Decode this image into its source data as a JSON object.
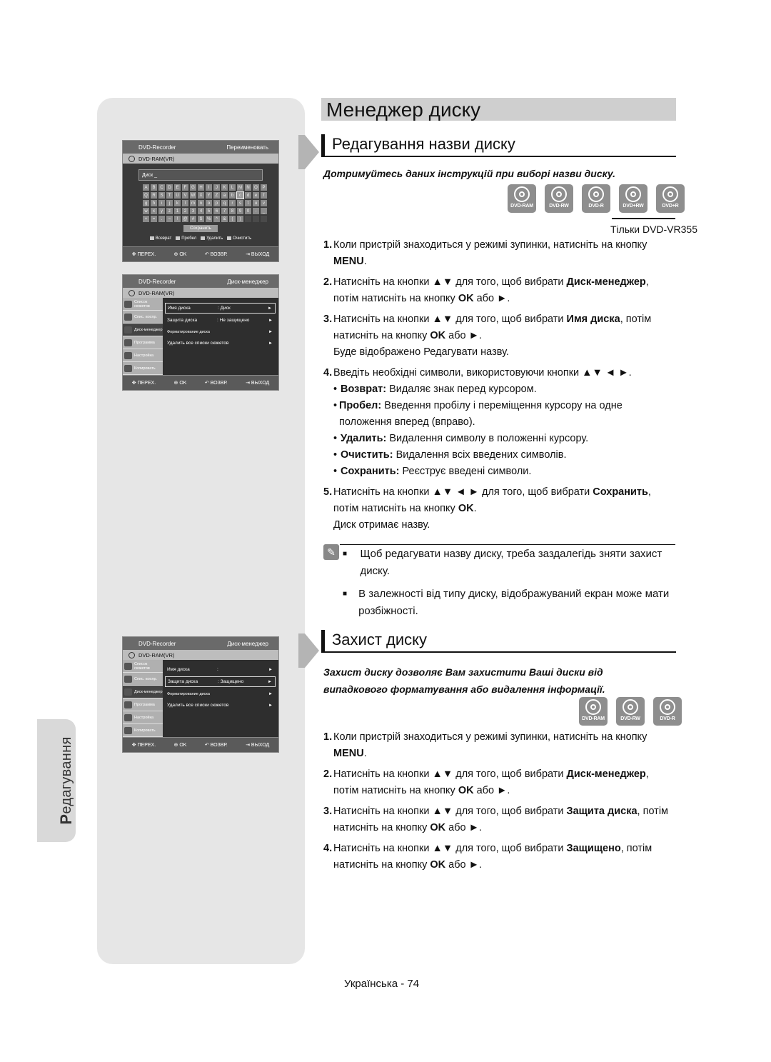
{
  "page": {
    "title": "Менеджер диску",
    "side_tab": {
      "cap": "Р",
      "rest": "едагування"
    },
    "footer": "Українська - 74"
  },
  "screen_rename": {
    "header_left": "DVD-Recorder",
    "header_right": "Переименовать",
    "disc_type": "DVD-RAM(VR)",
    "name_value": "Диск _",
    "keyboard_rows": [
      [
        "A",
        "B",
        "C",
        "D",
        "E",
        "F",
        "G",
        "H",
        "I",
        "J",
        "K",
        "L",
        "M",
        "N",
        "O",
        "P"
      ],
      [
        "Q",
        "R",
        "S",
        "T",
        "U",
        "V",
        "W",
        "X",
        "Y",
        "Z",
        "a",
        "b",
        "c",
        "d",
        "e",
        "f"
      ],
      [
        "g",
        "h",
        "i",
        "j",
        "k",
        "l",
        "m",
        "n",
        "o",
        "p",
        "q",
        "r",
        "s",
        "t",
        "u",
        "v"
      ],
      [
        "w",
        "x",
        "y",
        "z",
        "1",
        "2",
        "3",
        "4",
        "5",
        "6",
        "7",
        "8",
        "9",
        "0",
        "-",
        "_"
      ],
      [
        "+",
        "=",
        ".",
        "~",
        "!",
        "@",
        "#",
        "$",
        "%",
        "^",
        "&",
        "(",
        ")",
        "",
        "",
        ""
      ]
    ],
    "selected_key": "c",
    "save_label": "Сохранить",
    "legend": [
      "Возврат",
      "Пробел",
      "Удалить",
      "Очистить"
    ],
    "footer": [
      "ПЕРЕХ.",
      "OK",
      "ВОЗВР.",
      "ВЫХОД"
    ]
  },
  "screen_manager_1": {
    "header_left": "DVD-Recorder",
    "header_right": "Диск-менеджер",
    "disc_type": "DVD-RAM(VR)",
    "side_items": [
      "Список сюжетов",
      "Спис. воспр.",
      "Диск-менеджер",
      "Программа",
      "Настройка",
      "Копировать"
    ],
    "rows": [
      {
        "key": "Имя диска",
        "value": ": Диск",
        "selected": true
      },
      {
        "key": "Защита диска",
        "value": ": Не защищено",
        "selected": false
      },
      {
        "key": "Форматирование диска",
        "value": "",
        "selected": false
      },
      {
        "key": "Удалить все списки сюжетов",
        "value": "",
        "selected": false
      }
    ],
    "footer": [
      "ПЕРЕХ.",
      "OK",
      "ВОЗВР.",
      "ВЫХОД"
    ]
  },
  "screen_manager_2": {
    "header_left": "DVD-Recorder",
    "header_right": "Диск-менеджер",
    "disc_type": "DVD-RAM(VR)",
    "side_items": [
      "Список сюжетов",
      "Спис. воспр.",
      "Диск-менеджер",
      "Программа",
      "Настройка",
      "Копировать"
    ],
    "rows": [
      {
        "key": "Имя диска",
        "value": ":",
        "selected": false
      },
      {
        "key": "Защита диска",
        "value": ": Защищено",
        "selected": true
      },
      {
        "key": "Форматирование диска",
        "value": "",
        "selected": false
      },
      {
        "key": "Удалить все списки сюжетов",
        "value": "",
        "selected": false
      }
    ],
    "footer": [
      "ПЕРЕХ.",
      "OK",
      "ВОЗВР.",
      "ВЫХОД"
    ]
  },
  "section1": {
    "heading": "Редагування назви диску",
    "intro": "Дотримуйтесь даних інструкцій при виборі назви диску.",
    "discs": [
      "DVD-RAM",
      "DVD-RW",
      "DVD-R",
      "DVD+RW",
      "DVD+R"
    ],
    "only_note": "Тільки DVD-VR355",
    "steps": [
      {
        "n": "1",
        "parts": [
          [
            "Коли пристрій знаходиться у режимі зупинки, натисніть на кнопку ",
            false
          ],
          [
            "MENU",
            true
          ],
          [
            ".",
            false
          ]
        ]
      },
      {
        "n": "2",
        "parts": [
          [
            "Натисніть на кнопки ▲▼ для того, щоб вибрати ",
            false
          ],
          [
            "Диск-менеджер",
            true
          ],
          [
            ", потім натисніть на кнопку ",
            false
          ],
          [
            "OK",
            true
          ],
          [
            " або ►.",
            false
          ]
        ]
      },
      {
        "n": "3",
        "parts": [
          [
            "Натисніть на кнопки ▲▼ для того, щоб вибрати ",
            false
          ],
          [
            "Имя диска",
            true
          ],
          [
            ", потім натисніть на кнопку ",
            false
          ],
          [
            "OK",
            true
          ],
          [
            " або ►.",
            false
          ]
        ],
        "after": "Буде відображено Редагувати назву."
      },
      {
        "n": "4",
        "parts": [
          [
            "Введіть необхідні символи, використовуючи кнопки ▲▼ ◄ ►.",
            false
          ]
        ]
      }
    ],
    "bullets": [
      {
        "term": "Возврат:",
        "desc": "Видаляє знак перед курсором."
      },
      {
        "term": "Пробел:",
        "desc": "Введення пробілу і переміщення курсору на одне положення вперед (вправо)."
      },
      {
        "term": "Удалить:",
        "desc": "Видалення символу в положенні курсору."
      },
      {
        "term": "Очистить:",
        "desc": "Видалення всіх введених символів."
      },
      {
        "term": "Сохранить:",
        "desc": "Реєструє введені символи."
      }
    ],
    "step5": {
      "n": "5",
      "parts": [
        [
          "Натисніть на кнопки ▲▼ ◄ ► для того, щоб вибрати ",
          false
        ],
        [
          "Сохранить",
          true
        ],
        [
          ", потім натисніть на кнопку ",
          false
        ],
        [
          "OK",
          true
        ],
        [
          ".",
          false
        ]
      ],
      "after": "Диск отримає назву."
    },
    "notes": [
      "Щоб редагувати назву диску, треба заздалегідь зняти захист диску.",
      "В залежності від типу диску, відображуваний екран може мати розбіжності."
    ]
  },
  "section2": {
    "heading": "Захист диску",
    "intro": "Захист диску дозволяє Вам захистити Ваші диски від випадкового форматування або видалення інформації.",
    "discs": [
      "DVD-RAM",
      "DVD-RW",
      "DVD-R"
    ],
    "steps": [
      {
        "n": "1",
        "parts": [
          [
            "Коли пристрій знаходиться у режимі зупинки, натисніть на кнопку ",
            false
          ],
          [
            "MENU",
            true
          ],
          [
            ".",
            false
          ]
        ]
      },
      {
        "n": "2",
        "parts": [
          [
            "Натисніть на кнопки ▲▼ для того, щоб вибрати ",
            false
          ],
          [
            "Диск-менеджер",
            true
          ],
          [
            ", потім натисніть на кнопку ",
            false
          ],
          [
            "OK",
            true
          ],
          [
            " або ►.",
            false
          ]
        ]
      },
      {
        "n": "3",
        "parts": [
          [
            "Натисніть на кнопки ▲▼ для того, щоб вибрати ",
            false
          ],
          [
            "Защита диска",
            true
          ],
          [
            ", потім натисніть на кнопку ",
            false
          ],
          [
            "OK",
            true
          ],
          [
            " або ►.",
            false
          ]
        ]
      },
      {
        "n": "4",
        "parts": [
          [
            "Натисніть на кнопки ▲▼ для того, щоб вибрати ",
            false
          ],
          [
            "Защищено",
            true
          ],
          [
            ", потім натисніть на кнопку ",
            false
          ],
          [
            "OK",
            true
          ],
          [
            " або ►.",
            false
          ]
        ]
      }
    ]
  }
}
